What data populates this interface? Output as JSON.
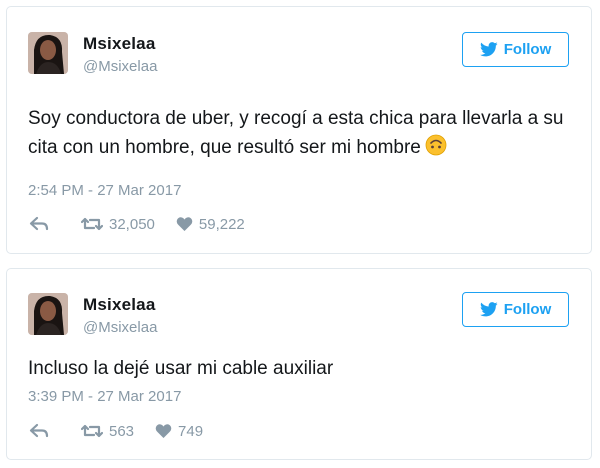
{
  "colors": {
    "accent": "#1da1f2",
    "text": "#14171a",
    "muted": "#8899a6",
    "border": "#e1e8ed"
  },
  "tweets": [
    {
      "name": "Msixelaa",
      "handle": "@Msixelaa",
      "follow_label": "Follow",
      "text_lines": [
        "Soy conductora de uber, y recogí a esta chica para llevarla a su",
        "cita con un hombre, que resultó ser mi hombre"
      ],
      "emoji": "upside-down-face-emoji",
      "timestamp": "2:54 PM - 27 Mar 2017",
      "retweets": "32,050",
      "likes": "59,222"
    },
    {
      "name": "Msixelaa",
      "handle": "@Msixelaa",
      "follow_label": "Follow",
      "text_lines": [
        "Incluso la dejé usar mi cable auxiliar"
      ],
      "timestamp": "3:39 PM - 27 Mar 2017",
      "retweets": "563",
      "likes": "749"
    }
  ]
}
